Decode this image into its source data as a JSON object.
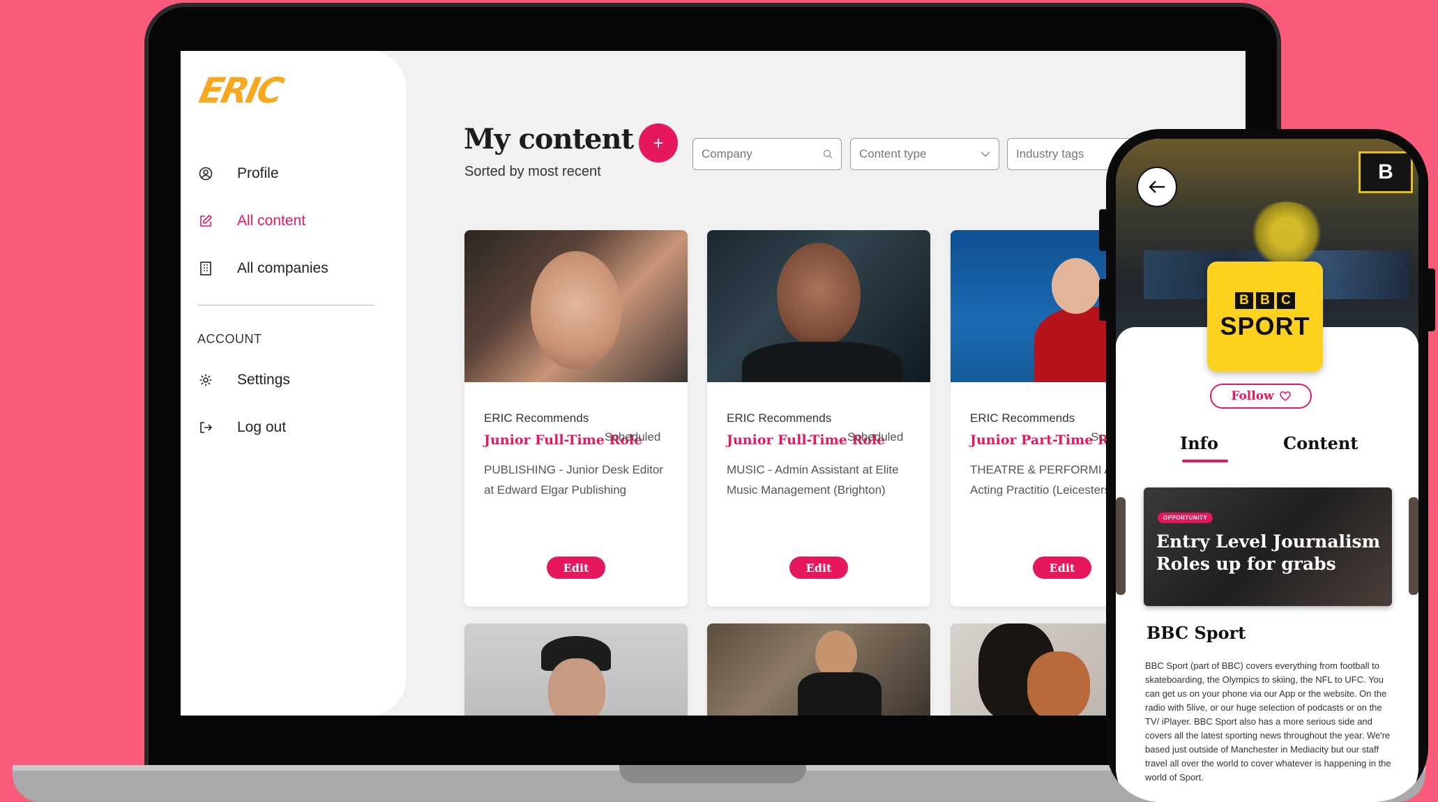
{
  "app": {
    "logo_text": "ERIC"
  },
  "sidebar": {
    "items": [
      {
        "label": "Profile",
        "icon": "user-circle-icon"
      },
      {
        "label": "All content",
        "icon": "edit-icon",
        "active": true
      },
      {
        "label": "All companies",
        "icon": "building-icon"
      }
    ],
    "account_label": "ACCOUNT",
    "account_items": [
      {
        "label": "Settings",
        "icon": "gear-icon"
      },
      {
        "label": "Log out",
        "icon": "logout-icon"
      }
    ]
  },
  "header": {
    "title": "My content",
    "subtitle": "Sorted by most recent",
    "add_label": "+",
    "filters": {
      "company_placeholder": "Company",
      "content_type_placeholder": "Content type",
      "industry_tags_placeholder": "Industry tags"
    }
  },
  "cards": [
    {
      "tag": "ERIC Recommends",
      "headline": "Junior Full-Time Role",
      "status": "Scheduled",
      "description": "PUBLISHING - Junior Desk Editor at Edward Elgar Publishing",
      "edit_label": "Edit"
    },
    {
      "tag": "ERIC Recommends",
      "headline": "Junior Full-Time Role",
      "status": "Scheduled",
      "description": "MUSIC - Admin Assistant at Elite Music Management (Brighton)",
      "edit_label": "Edit"
    },
    {
      "tag": "ERIC Recommends",
      "headline": "Junior Part-Time Role",
      "status": "Sc",
      "description": "THEATRE & PERFORMI ARTS - Acting Practitio (Leicestershire)",
      "edit_label": "Edit"
    }
  ],
  "colors": {
    "accent": "#e6185c",
    "background": "#fb5b7b",
    "bbc_yellow": "#fcd21e"
  },
  "phone": {
    "back_icon": "arrow-left-icon",
    "hero_sign": "B",
    "brand_letters": [
      "B",
      "B",
      "C"
    ],
    "brand_word": "SPORT",
    "follow_label": "Follow",
    "tabs": [
      {
        "label": "Info",
        "active": true
      },
      {
        "label": "Content"
      }
    ],
    "feature": {
      "badge": "OPPORTUNITY",
      "title": "Entry Level Journalism Roles up for grabs"
    },
    "company_name": "BBC Sport",
    "company_description": "BBC Sport (part of BBC) covers everything from football to skateboarding, the Olympics to skiing, the NFL to UFC. You can get us on your phone via our App or the website. On the radio with 5live, or our huge selection of podcasts or on the TV/ iPlayer. BBC Sport also has a more serious side and covers all the latest sporting news throughout the year. We're based just outside of Manchester in Mediacity but our staff travel all over the world to cover whatever is happening in the world of Sport."
  }
}
